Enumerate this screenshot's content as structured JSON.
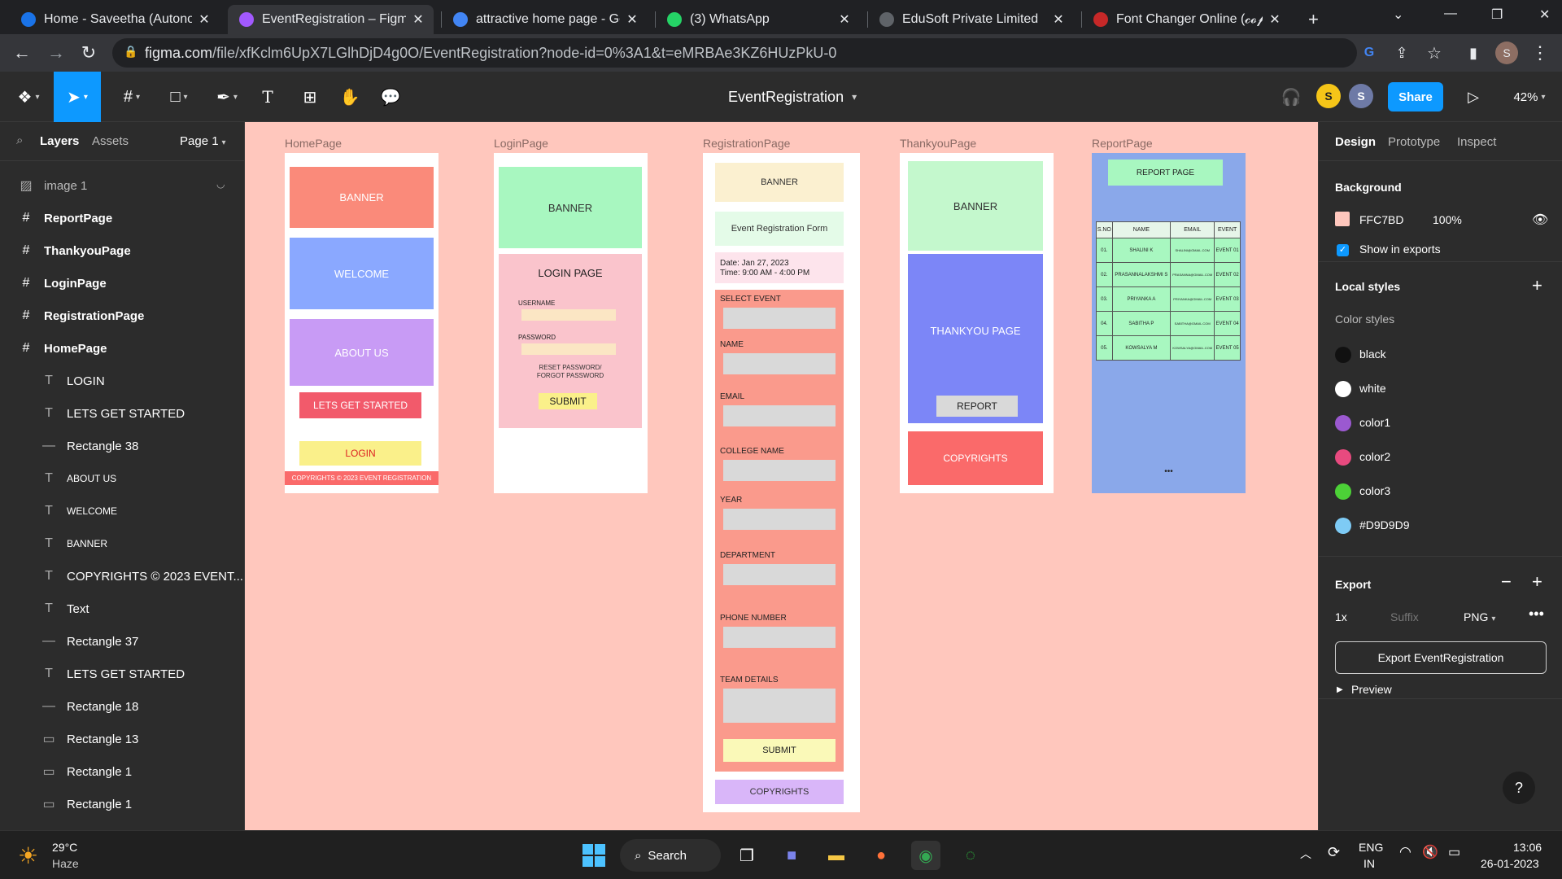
{
  "browser": {
    "tabs": [
      {
        "label": "Home - Saveetha (Autonon",
        "icon": "saveetha-icon",
        "color": "#1a73e8"
      },
      {
        "label": "EventRegistration – Figma",
        "icon": "figma-icon",
        "color": "#a259ff"
      },
      {
        "label": "attractive home page - Goo",
        "icon": "google-icon",
        "color": "#4285f4"
      },
      {
        "label": "(3) WhatsApp",
        "icon": "whatsapp-icon",
        "color": "#25d366"
      },
      {
        "label": "EduSoft Private Limited",
        "icon": "globe-icon",
        "color": "#5f6368"
      },
      {
        "label": "Font Changer Online (𝓬𝓸𝓹𝔂",
        "icon": "font-changer-icon",
        "color": "#c62828"
      }
    ],
    "close_glyph": "✕",
    "new_tab": "+",
    "url_host": "figma.com",
    "url_path": "/file/xfKclm6UpX7LGlhDjD4g0O/EventRegistration?node-id=0%3A1&t=eMRBAe3KZ6HUzPkU-0",
    "profile_initial": "S"
  },
  "figma": {
    "file_title": "EventRegistration",
    "share_label": "Share",
    "zoom": "42%",
    "collab_initials": [
      "S",
      "S"
    ]
  },
  "left_panel": {
    "tabs": [
      "Layers",
      "Assets"
    ],
    "page": "Page 1",
    "layers": [
      {
        "name": "image 1",
        "type": "image",
        "bold": false,
        "indent": false
      },
      {
        "name": "ReportPage",
        "type": "frame",
        "bold": true,
        "indent": false
      },
      {
        "name": "ThankyouPage",
        "type": "frame",
        "bold": true,
        "indent": false
      },
      {
        "name": "LoginPage",
        "type": "frame",
        "bold": true,
        "indent": false
      },
      {
        "name": "RegistrationPage",
        "type": "frame",
        "bold": true,
        "indent": false
      },
      {
        "name": "HomePage",
        "type": "frame",
        "bold": true,
        "indent": false
      },
      {
        "name": "LOGIN",
        "type": "text",
        "bold": false,
        "indent": true
      },
      {
        "name": "LETS GET STARTED",
        "type": "text",
        "bold": false,
        "indent": true
      },
      {
        "name": "Rectangle 38",
        "type": "line",
        "bold": false,
        "indent": true
      },
      {
        "name": "ABOUT US",
        "type": "text",
        "bold": false,
        "indent": true,
        "small": true
      },
      {
        "name": "WELCOME",
        "type": "text",
        "bold": false,
        "indent": true,
        "small": true
      },
      {
        "name": "BANNER",
        "type": "text",
        "bold": false,
        "indent": true,
        "small": true
      },
      {
        "name": "COPYRIGHTS © 2023 EVENT...",
        "type": "text",
        "bold": false,
        "indent": true
      },
      {
        "name": "Text",
        "type": "text",
        "bold": false,
        "indent": true
      },
      {
        "name": "Rectangle 37",
        "type": "line",
        "bold": false,
        "indent": true
      },
      {
        "name": "LETS GET STARTED",
        "type": "text",
        "bold": false,
        "indent": true
      },
      {
        "name": "Rectangle 18",
        "type": "line",
        "bold": false,
        "indent": true
      },
      {
        "name": "Rectangle 13",
        "type": "rect",
        "bold": false,
        "indent": true
      },
      {
        "name": "Rectangle 1",
        "type": "rect",
        "bold": false,
        "indent": true
      },
      {
        "name": "Rectangle 1",
        "type": "rect",
        "bold": false,
        "indent": true
      }
    ]
  },
  "right_panel": {
    "tabs": [
      "Design",
      "Prototype",
      "Inspect"
    ],
    "background_title": "Background",
    "background_hex": "FFC7BD",
    "background_opacity": "100%",
    "show_in_exports": "Show in exports",
    "local_styles": "Local styles",
    "color_styles_title": "Color styles",
    "color_styles": [
      {
        "name": "black",
        "color": "#111111"
      },
      {
        "name": "white",
        "color": "#ffffff"
      },
      {
        "name": "color1",
        "color": "#9b59d0"
      },
      {
        "name": "color2",
        "color": "#e84a7f"
      },
      {
        "name": "color3",
        "color": "#4cd137"
      },
      {
        "name": "#D9D9D9",
        "color": "#7ecbf5"
      }
    ],
    "export_title": "Export",
    "export_scale": "1x",
    "export_suffix_placeholder": "Suffix",
    "export_format": "PNG",
    "export_button": "Export EventRegistration",
    "preview": "Preview",
    "help": "?"
  },
  "canvas": {
    "home": {
      "label": "HomePage",
      "banner": "BANNER",
      "welcome": "WELCOME",
      "about": "ABOUT US",
      "started": "LETS GET STARTED",
      "login": "LOGIN",
      "copyright": "COPYRIGHTS © 2023 EVENT REGISTRATION"
    },
    "login": {
      "label": "LoginPage",
      "banner": "BANNER",
      "title": "LOGIN PAGE",
      "username": "USERNAME",
      "password": "PASSWORD",
      "reset": "RESET PASSWORD/",
      "forgot": "FORGOT PASSWORD",
      "submit": "SUBMIT"
    },
    "registration": {
      "label": "RegistrationPage",
      "banner": "BANNER",
      "form_title": "Event Registration Form",
      "date": "Date: Jan 27, 2023",
      "time": "Time: 9:00 AM - 4:00 PM",
      "fields": [
        "SELECT EVENT",
        "NAME",
        "EMAIL",
        "COLLEGE NAME",
        "YEAR",
        "DEPARTMENT",
        "PHONE NUMBER",
        "TEAM DETAILS"
      ],
      "submit": "SUBMIT",
      "copyrights": "COPYRIGHTS"
    },
    "thankyou": {
      "label": "ThankyouPage",
      "banner": "BANNER",
      "title": "THANKYOU PAGE",
      "report": "REPORT",
      "copyrights": "COPYRIGHTS"
    },
    "report": {
      "label": "ReportPage",
      "title": "REPORT PAGE",
      "headers": [
        "S.NO",
        "NAME",
        "EMAIL",
        "EVENT"
      ],
      "rows": [
        [
          "01.",
          "SHALINI K",
          "SHALINI@GMAIL.COM",
          "EVENT 01"
        ],
        [
          "02.",
          "PRASANNALAKSHMI S",
          "PRASANNA@GMAIL.COM",
          "EVENT 02"
        ],
        [
          "03.",
          "PRIYANKA A",
          "PRIYANKA@GMAIL.COM",
          "EVENT 03"
        ],
        [
          "04.",
          "SABITHA P",
          "SABITHA@GMAIL.COM",
          "EVENT 04"
        ],
        [
          "05.",
          "KOWSALYA M",
          "KOWSALYA@GMAIL.COM",
          "EVENT 05"
        ]
      ],
      "more": "•••"
    }
  },
  "taskbar": {
    "temp": "29°C",
    "weather": "Haze",
    "search": "Search",
    "lang": "ENG",
    "region": "IN",
    "time": "13:06",
    "date": "26-01-2023"
  }
}
